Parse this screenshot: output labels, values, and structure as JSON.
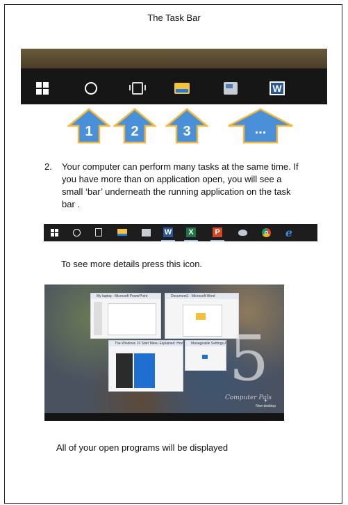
{
  "title": "The Task Bar",
  "arrows": [
    "1",
    "2",
    "3",
    "..."
  ],
  "paragraph": {
    "number": "2.",
    "text": "Your computer can perform many tasks at the same time. If you have more than on application open, you will see a  small ‘bar’ underneath the running application on the task bar ."
  },
  "caption_details": "To see more details press this icon.",
  "screenshot": {
    "windows": [
      "My laptop - Microsoft PowerPoint",
      "Document1 - Microsoft Word",
      "The Windows 10 Start Menu Explained: How to Customize and Use...",
      "Manageable Settings Apps"
    ],
    "watermark_number": "5",
    "watermark_text": "Computer Pals",
    "new_desktop": "New desktop"
  },
  "caption_programs": "All of your open programs will be displayed",
  "colors": {
    "arrow_fill": "#4a90d9",
    "arrow_stroke": "#f2b840",
    "taskbar": "#161616"
  }
}
